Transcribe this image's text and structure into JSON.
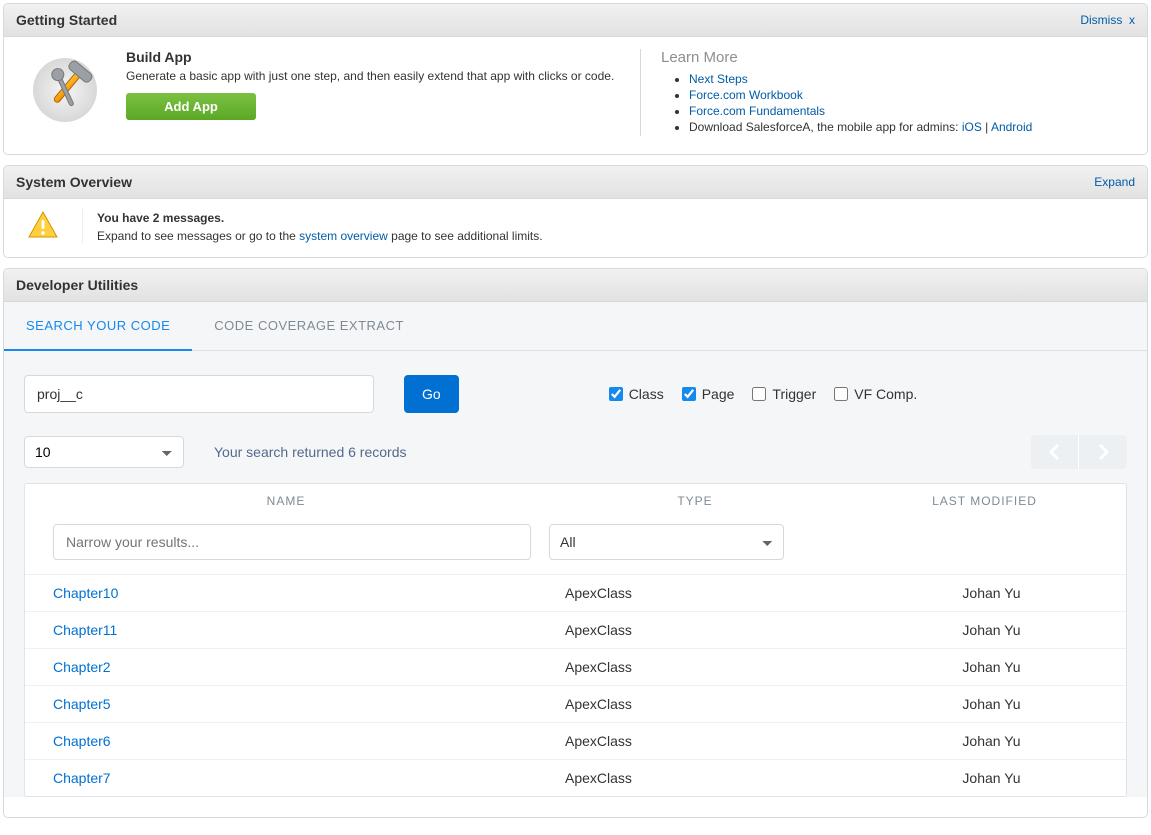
{
  "getting_started": {
    "title": "Getting Started",
    "dismiss_label": "Dismiss",
    "dismiss_x": "x",
    "build_app_title": "Build App",
    "build_app_desc": "Generate a basic app with just one step, and then easily extend that app with clicks or code.",
    "add_app_label": "Add App",
    "learn_more_title": "Learn More",
    "links": {
      "next_steps": "Next Steps",
      "workbook": "Force.com Workbook",
      "fundamentals": "Force.com Fundamentals"
    },
    "download_prefix": "Download SalesforceA, the mobile app for admins: ",
    "ios": "iOS",
    "sep": " | ",
    "android": "Android"
  },
  "system_overview": {
    "title": "System Overview",
    "expand_label": "Expand",
    "msg_bold": "You have 2 messages.",
    "msg_pre": "Expand to see messages or go to the ",
    "msg_link": "system overview",
    "msg_post": " page to see additional limits."
  },
  "dev": {
    "title": "Developer Utilities",
    "tabs": {
      "search": "SEARCH YOUR CODE",
      "coverage": "CODE COVERAGE EXTRACT"
    },
    "search_value": "proj__c",
    "go_label": "Go",
    "checks": {
      "class": "Class",
      "page": "Page",
      "trigger": "Trigger",
      "vfcomp": "VF Comp."
    },
    "page_size": "10",
    "results_msg": "Your search returned 6 records",
    "columns": {
      "name": "NAME",
      "type": "TYPE",
      "modified": "LAST MODIFIED"
    },
    "filter_name_placeholder": "Narrow your results...",
    "filter_type_value": "All",
    "rows": [
      {
        "name": "Chapter10",
        "type": "ApexClass",
        "modified": "Johan Yu"
      },
      {
        "name": "Chapter11",
        "type": "ApexClass",
        "modified": "Johan Yu"
      },
      {
        "name": "Chapter2",
        "type": "ApexClass",
        "modified": "Johan Yu"
      },
      {
        "name": "Chapter5",
        "type": "ApexClass",
        "modified": "Johan Yu"
      },
      {
        "name": "Chapter6",
        "type": "ApexClass",
        "modified": "Johan Yu"
      },
      {
        "name": "Chapter7",
        "type": "ApexClass",
        "modified": "Johan Yu"
      }
    ]
  }
}
